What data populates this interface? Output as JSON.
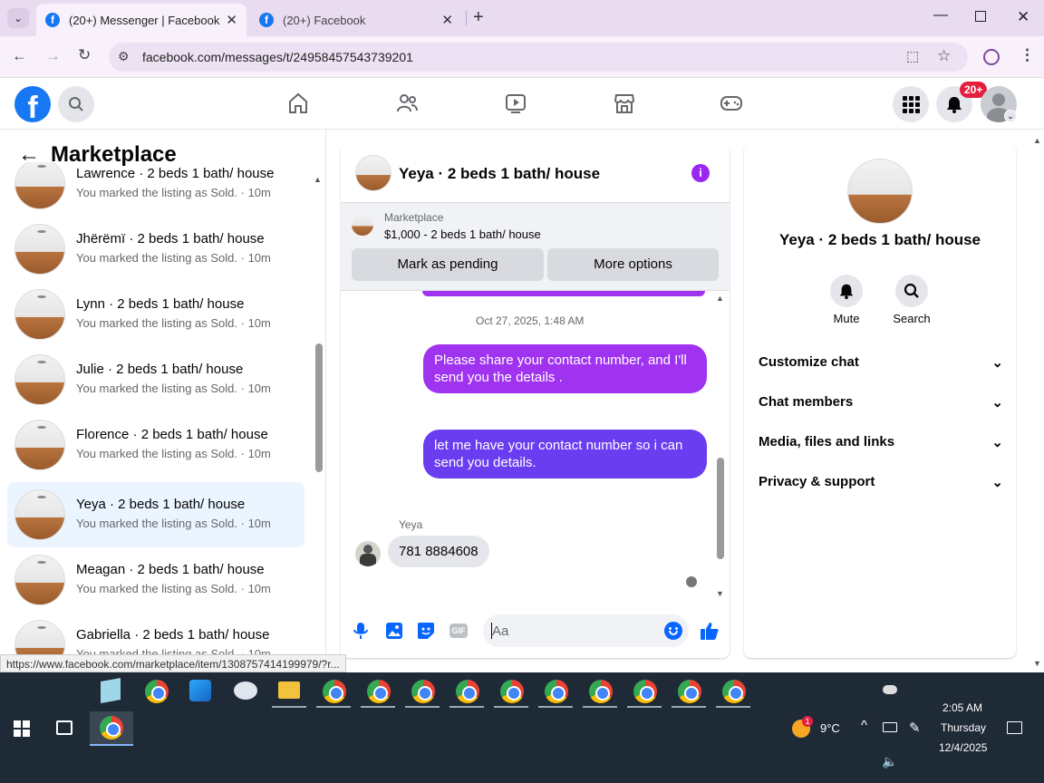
{
  "browser": {
    "tabs": [
      {
        "title": "(20+) Messenger | Facebook"
      },
      {
        "title": "(20+) Facebook"
      }
    ],
    "url": "facebook.com/messages/t/24958457543739201",
    "status_url": "https://www.facebook.com/marketplace/item/1308757414199979/?r..."
  },
  "header": {
    "notification_badge": "20+"
  },
  "sidebar": {
    "title": "Marketplace",
    "conversations": [
      {
        "name": "Lawrence · 2 beds 1 bath/ house",
        "sub": "You marked the listing as Sold. · 10m"
      },
      {
        "name": "Jhërëmï · 2 beds 1 bath/ house",
        "sub": "You marked the listing as Sold. · 10m"
      },
      {
        "name": "Lynn · 2 beds 1 bath/ house",
        "sub": "You marked the listing as Sold. · 10m"
      },
      {
        "name": "Julie · 2 beds 1 bath/ house",
        "sub": "You marked the listing as Sold. · 10m"
      },
      {
        "name": "Florence · 2 beds 1 bath/ house",
        "sub": "You marked the listing as Sold. · 10m"
      },
      {
        "name": "Yeya · 2 beds 1 bath/ house",
        "sub": "You marked the listing as Sold. · 10m"
      },
      {
        "name": "Meagan · 2 beds 1 bath/ house",
        "sub": "You marked the listing as Sold. · 10m"
      },
      {
        "name": "Gabriella · 2 beds 1 bath/ house",
        "sub": "You marked the listing as Sold. · 10m"
      }
    ]
  },
  "chat": {
    "title": "Yeya · 2 beds 1 bath/ house",
    "listing_source": "Marketplace",
    "listing_desc": "$1,000 - 2 beds 1 bath/ house",
    "mark_pending": "Mark as pending",
    "more_options": "More options",
    "timestamp": "Oct 27, 2025, 1:48 AM",
    "messages": [
      {
        "text": "Please share your contact number, and I'll send you the details ."
      },
      {
        "text": "let me have your contact number so i can send you details."
      }
    ],
    "reply_sender": "Yeya",
    "reply_text": "781 8884608",
    "composer_placeholder": "Aa"
  },
  "info": {
    "name": "Yeya · 2 beds 1 bath/ house",
    "mute": "Mute",
    "search": "Search",
    "sections": [
      "Customize chat",
      "Chat members",
      "Media, files and links",
      "Privacy & support"
    ]
  },
  "taskbar": {
    "weather_temp": "9°C",
    "weather_badge": "1",
    "time": "2:05 AM",
    "day": "Thursday",
    "date": "12/4/2025"
  },
  "colors": {
    "fb_blue": "#1877f2",
    "bubble_purple": "#a033f0",
    "bubble_indigo": "#6a3df0",
    "info_purple": "#9b26f0"
  }
}
